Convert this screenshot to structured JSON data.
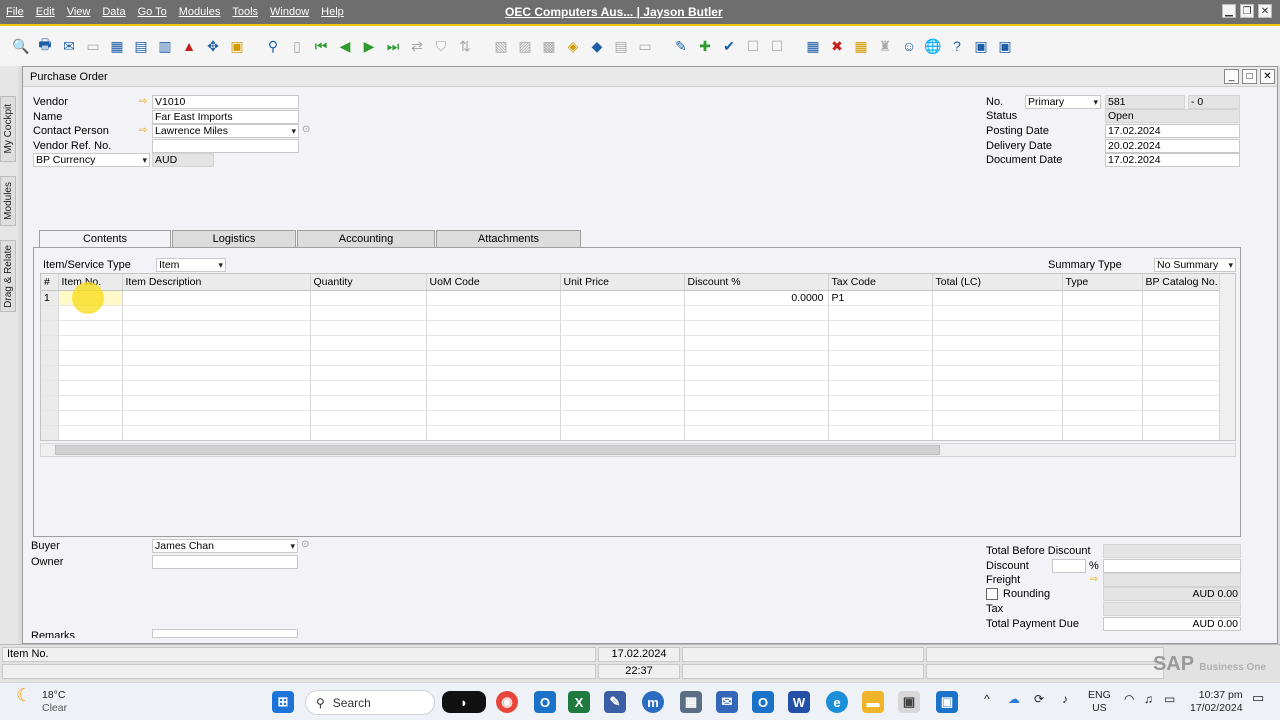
{
  "menubar": {
    "items": [
      "File",
      "Edit",
      "View",
      "Data",
      "Go To",
      "Modules",
      "Tools",
      "Window",
      "Help"
    ],
    "title": "OEC Computers Aus... | Jayson Butler"
  },
  "sidebar": {
    "tabs": [
      "My Cockpit",
      "Modules",
      "Drag & Relate"
    ]
  },
  "window": {
    "title": "Purchase Order"
  },
  "header": {
    "vendor_label": "Vendor",
    "vendor_value": "V1010",
    "name_label": "Name",
    "name_value": "Far East Imports",
    "contact_label": "Contact Person",
    "contact_value": "Lawrence Miles",
    "vendor_ref_label": "Vendor Ref. No.",
    "vendor_ref_value": "",
    "currency_label": "BP Currency",
    "currency_value": "AUD",
    "no_label": "No.",
    "series_value": "Primary",
    "doc_num": "581",
    "doc_num_suffix": "- 0",
    "status_label": "Status",
    "status_value": "Open",
    "posting_label": "Posting Date",
    "posting_value": "17.02.2024",
    "delivery_label": "Delivery Date",
    "delivery_value": "20.02.2024",
    "document_label": "Document Date",
    "document_value": "17.02.2024"
  },
  "tabs": [
    "Contents",
    "Logistics",
    "Accounting",
    "Attachments"
  ],
  "contents": {
    "item_service_label": "Item/Service Type",
    "item_service_value": "Item",
    "summary_label": "Summary Type",
    "summary_value": "No Summary"
  },
  "grid": {
    "columns": [
      "#",
      "Item No.",
      "Item Description",
      "Quantity",
      "UoM Code",
      "Unit Price",
      "Discount %",
      "Tax Code",
      "Total (LC)",
      "Type",
      "BP Catalog No."
    ],
    "rows": [
      [
        "1",
        "",
        "",
        "",
        "",
        "",
        "0.0000",
        "P1",
        "",
        "",
        ""
      ]
    ]
  },
  "footer": {
    "buyer_label": "Buyer",
    "buyer_value": "James Chan",
    "owner_label": "Owner",
    "owner_value": "",
    "remarks_label": "Remarks",
    "total_before_label": "Total Before Discount",
    "total_before_value": "",
    "discount_label": "Discount",
    "discount_pct": "",
    "pct_sign": "%",
    "discount_value": "",
    "freight_label": "Freight",
    "freight_value": "",
    "rounding_label": "Rounding",
    "rounding_value": "AUD 0.00",
    "tax_label": "Tax",
    "tax_value": "",
    "total_due_label": "Total Payment Due",
    "total_due_value": "AUD 0.00"
  },
  "statusbar": {
    "field_name": "Item No.",
    "date": "17.02.2024",
    "time": "22:37",
    "brand": "SAP",
    "brand_sub": "Business One"
  },
  "taskbar": {
    "weather_temp": "18°C",
    "weather_desc": "Clear",
    "search_placeholder": "Search",
    "lang": "ENG",
    "region": "US",
    "clock_time": "10:37 pm",
    "clock_date": "17/02/2024"
  },
  "colors": {
    "accent": "#f3c500",
    "menubar": "#6e6e6e",
    "highlight": "#fadc14"
  }
}
